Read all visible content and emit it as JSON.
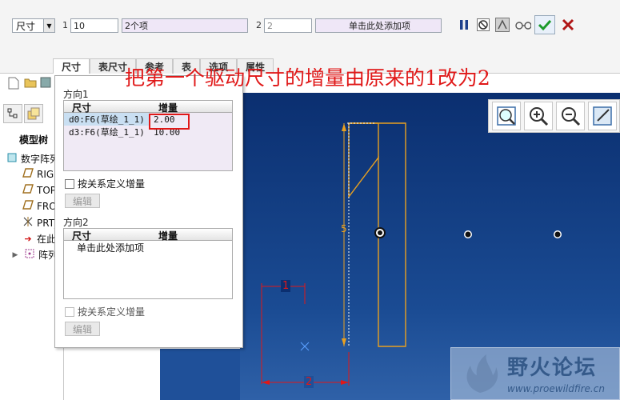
{
  "dashboard": {
    "type_select": "尺寸",
    "dir1_number": "1",
    "dir1_value": "10",
    "dir1_items": "2个项",
    "dir2_number": "2",
    "dir2_value": "2",
    "dir2_items": "单击此处添加项"
  },
  "tabs": [
    "尺寸",
    "表尺寸",
    "参考",
    "表",
    "选项",
    "属性"
  ],
  "tree": {
    "title": "模型树",
    "items": [
      "数字阵列",
      "RIGHT",
      "TOP",
      "FRONT",
      "PRT_CSYS_DEF",
      "在此插入",
      "阵列"
    ]
  },
  "dialog": {
    "dir1_label": "方向1",
    "col_dim": "尺寸",
    "col_inc": "增量",
    "rows1": [
      {
        "dim": "d0:F6(草绘_1_1)",
        "inc": "2.00"
      },
      {
        "dim": "d3:F6(草绘_1_1)",
        "inc": "10.00"
      }
    ],
    "relation_label": "按关系定义增量",
    "edit_label": "编辑",
    "dir2_label": "方向2",
    "add_item": "单击此处添加项",
    "relation_label2": "按关系定义增量",
    "edit_label2": "编辑"
  },
  "annotation": "把第一个驱动尺寸的增量由原来的1改为2",
  "sketch": {
    "dim_height": "5",
    "dim_top": "1",
    "dim_bottom": "2"
  },
  "watermark": {
    "title": "野火论坛",
    "url": "www.proewildfire.cn"
  },
  "colors": {
    "accent_red": "#e01818",
    "sketch_orange": "#e8a020",
    "background_blue": "#0b2f70"
  }
}
